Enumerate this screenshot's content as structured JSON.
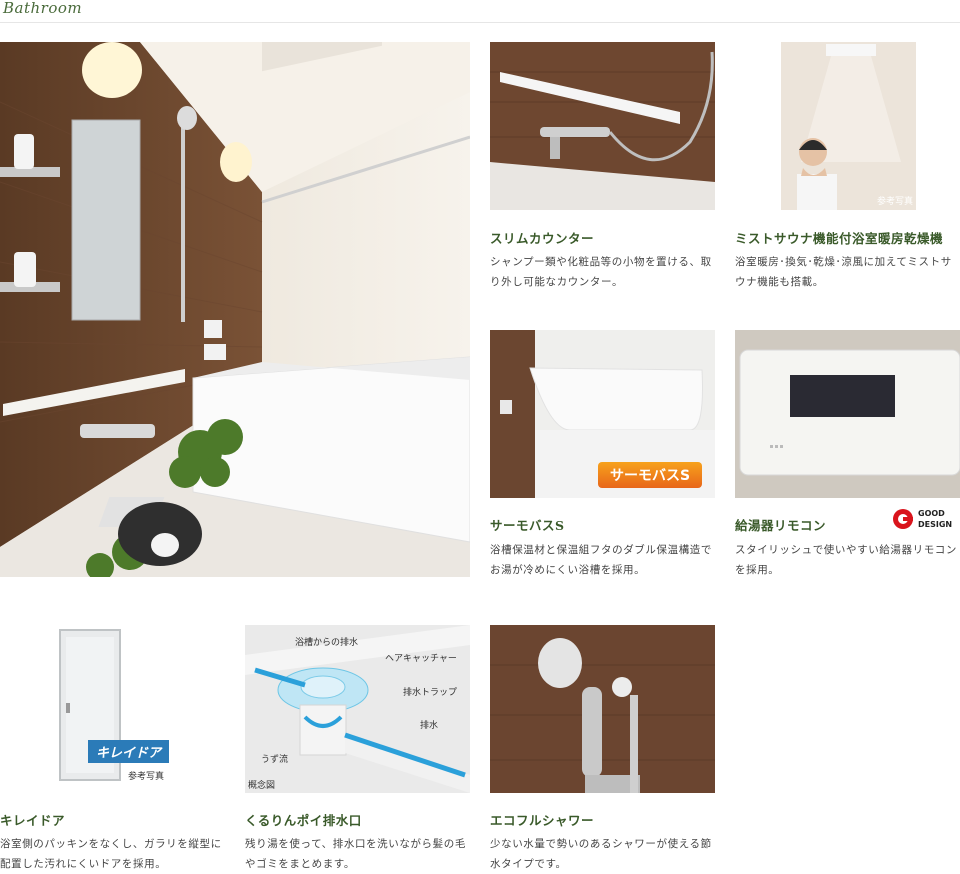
{
  "header": {
    "title": "Bathroom"
  },
  "features": [
    {
      "title": "スリムカウンター",
      "desc": "シャンプー類や化粧品等の小物を置ける、取り外し可能なカウンター。"
    },
    {
      "title": "ミストサウナ機能付浴室暖房乾燥機",
      "desc": "浴室暖房･換気･乾燥･涼風に加えてミストサウナ機能も搭載。",
      "photo_note": "参考写真"
    },
    {
      "title": "サーモバスS",
      "desc": "浴槽保温材と保温組フタのダブル保温構造でお湯が冷めにくい浴槽を採用。",
      "logo_text": "サーモバスS"
    },
    {
      "title": "給湯器リモコン",
      "desc": "スタイリッシュで使いやすい給湯器リモコンを採用。",
      "badge": [
        "GOOD",
        "DESIGN"
      ]
    },
    {
      "title": "キレイドア",
      "desc": "浴室側のパッキンをなくし、ガラリを縦型に配置した汚れにくいドアを採用。",
      "logo_text": "キレイドア",
      "photo_note": "参考写真"
    },
    {
      "title": "くるりんポイ排水口",
      "desc": "残り湯を使って、排水口を洗いながら髪の毛やゴミをまとめます。",
      "diagram_labels": [
        "浴槽からの排水",
        "ヘアキャッチャー",
        "排水トラップ",
        "排水",
        "うず流",
        "概念図"
      ]
    },
    {
      "title": "エコフルシャワー",
      "desc": "少ない水量で勢いのあるシャワーが使える節水タイプです。"
    }
  ]
}
